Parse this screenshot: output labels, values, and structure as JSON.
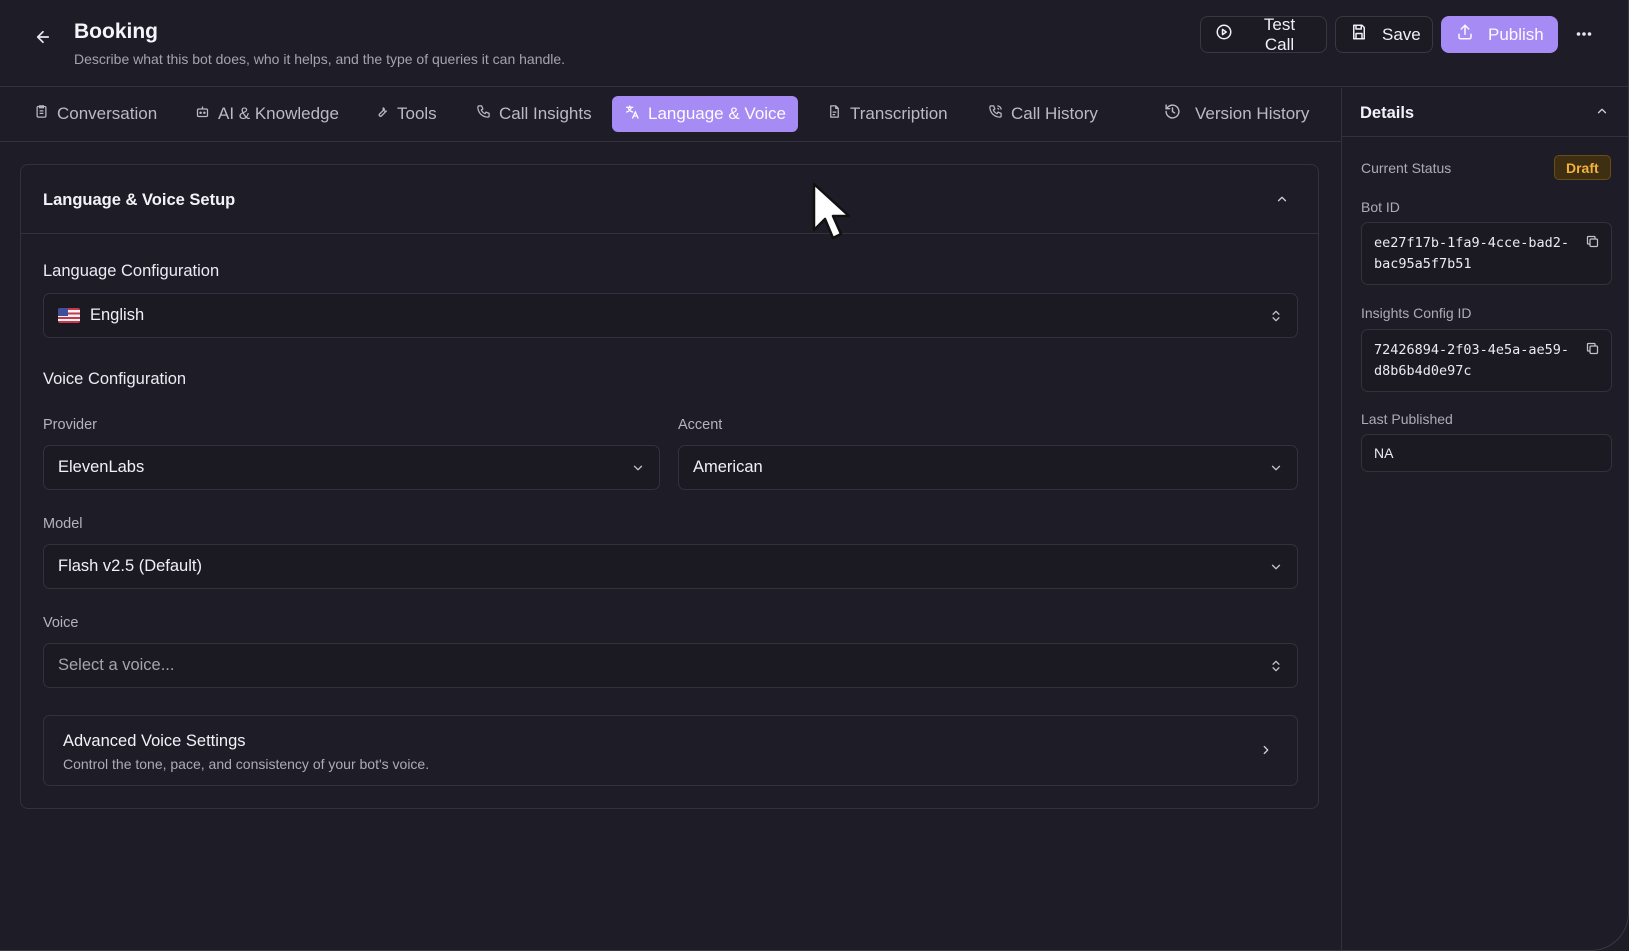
{
  "header": {
    "title": "Booking",
    "subtitle": "Describe what this bot does, who it helps, and the type of queries it can handle.",
    "test_call_label": "Test Call",
    "save_label": "Save",
    "publish_label": "Publish"
  },
  "tabs": [
    {
      "label": "Conversation",
      "icon": "clipboard-icon"
    },
    {
      "label": "AI & Knowledge",
      "icon": "bot-icon"
    },
    {
      "label": "Tools",
      "icon": "wrench-icon"
    },
    {
      "label": "Call Insights",
      "icon": "phone-icon"
    },
    {
      "label": "Language & Voice",
      "icon": "translate-icon",
      "active": true
    },
    {
      "label": "Transcription",
      "icon": "file-text-icon"
    },
    {
      "label": "Call History",
      "icon": "phone-call-icon"
    },
    {
      "label": "Version History",
      "icon": "history-icon"
    }
  ],
  "card": {
    "title": "Language & Voice Setup",
    "language_section": "Language Configuration",
    "language_value": "English",
    "voice_section": "Voice Configuration",
    "provider_label": "Provider",
    "provider_value": "ElevenLabs",
    "accent_label": "Accent",
    "accent_value": "American",
    "model_label": "Model",
    "model_value": "Flash v2.5 (Default)",
    "voice_label": "Voice",
    "voice_placeholder": "Select a voice...",
    "advanced_title": "Advanced Voice Settings",
    "advanced_desc": "Control the tone, pace, and consistency of your bot's voice."
  },
  "details": {
    "title": "Details",
    "status_label": "Current Status",
    "status_value": "Draft",
    "bot_id_label": "Bot ID",
    "bot_id": "ee27f17b-1fa9-4cce-bad2-bac95a5f7b51",
    "insights_label": "Insights Config ID",
    "insights_id": "72426894-2f03-4e5a-ae59-d8b6b4d0e97c",
    "last_published_label": "Last Published",
    "last_published": "NA"
  },
  "colors": {
    "accent": "#a58bf3",
    "background": "#1e1c26",
    "draft_badge": "#f2b23e"
  }
}
